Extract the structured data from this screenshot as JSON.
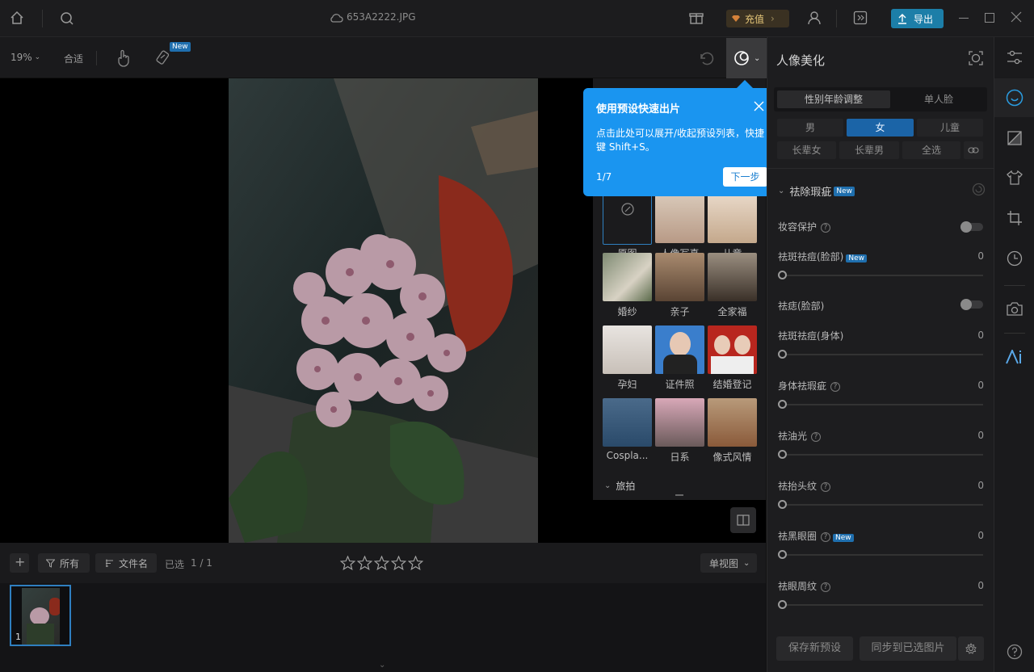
{
  "titlebar": {
    "filename": "653A2222.JPG",
    "recharge_label": "充值",
    "export_label": "导出"
  },
  "toolbar": {
    "zoom": "19%",
    "fit_label": "合适",
    "new_badge": "New"
  },
  "tooltip": {
    "title": "使用预设快速出片",
    "body": "点击此处可以展开/收起预设列表，快捷键 Shift+S。",
    "step": "1/7",
    "next_label": "下一步"
  },
  "presets": {
    "items": [
      {
        "label": "原图"
      },
      {
        "label": "人像写真"
      },
      {
        "label": "儿童"
      },
      {
        "label": "婚纱"
      },
      {
        "label": "亲子"
      },
      {
        "label": "全家福"
      },
      {
        "label": "孕妇"
      },
      {
        "label": "证件照"
      },
      {
        "label": "结婚登记"
      },
      {
        "label": "Cospla..."
      },
      {
        "label": "日系"
      },
      {
        "label": "像式风情"
      }
    ],
    "section_travel": "旅拍"
  },
  "bottombar": {
    "filter_label": "所有",
    "sort_label": "文件名",
    "selected_label": "已选",
    "selected_count": "1 / 1",
    "view_label": "单视图"
  },
  "filmstrip": {
    "items": [
      {
        "index": "1"
      }
    ]
  },
  "rightpanel": {
    "title": "人像美化",
    "tabs": [
      "性别年龄调整",
      "单人脸"
    ],
    "gender": [
      "男",
      "女",
      "儿童"
    ],
    "age": [
      "长辈女",
      "长辈男",
      "全选"
    ],
    "section_title": "祛除瑕疵",
    "new_badge": "New",
    "settings": [
      {
        "label": "妆容保护",
        "type": "toggle",
        "help": true
      },
      {
        "label": "祛斑祛痘(脸部)",
        "type": "slider",
        "value": "0",
        "new": true
      },
      {
        "label": "祛痣(脸部)",
        "type": "toggle"
      },
      {
        "label": "祛斑祛痘(身体)",
        "type": "slider",
        "value": "0"
      },
      {
        "label": "身体祛瑕疵",
        "type": "slider",
        "value": "0",
        "help": true
      },
      {
        "label": "祛油光",
        "type": "slider",
        "value": "0",
        "help": true
      },
      {
        "label": "祛抬头纹",
        "type": "slider",
        "value": "0",
        "help": true
      },
      {
        "label": "祛黑眼圈",
        "type": "slider",
        "value": "0",
        "help": true,
        "new": true
      },
      {
        "label": "祛眼周纹",
        "type": "slider",
        "value": "0",
        "help": true
      }
    ],
    "save_preset_label": "保存新预设",
    "sync_label": "同步到已选图片"
  },
  "colors": {
    "accent": "#1a95f0",
    "export": "#1c7ea8",
    "active_tab": "#1b64a7",
    "recharge_text": "#e6c77a"
  }
}
